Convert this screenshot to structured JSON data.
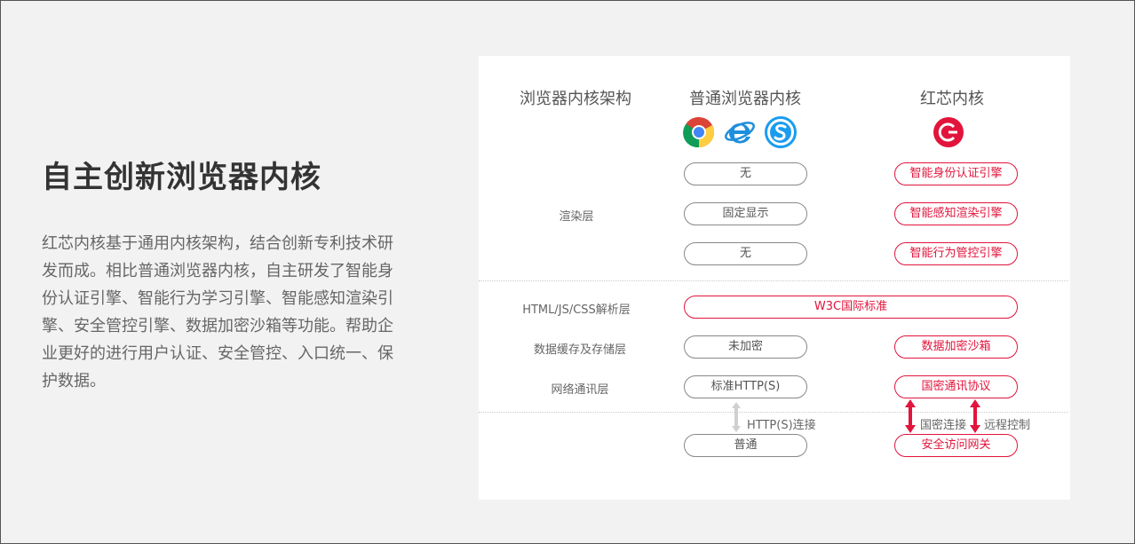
{
  "intro": {
    "title": "自主创新浏览器内核",
    "description": "红芯内核基于通用内核架构，结合创新专利技术研发而成。相比普通浏览器内核，自主研发了智能身份认证引擎、智能行为学习引擎、智能感知渲染引擎、安全管控引擎、数据加密沙箱等功能。帮助企业更好的进行用户认证、安全管控、入口统一、保护数据。"
  },
  "table": {
    "headers": {
      "architecture": "浏览器内核架构",
      "normal": "普通浏览器内核",
      "redcore": "红芯内核"
    },
    "render_layer": {
      "label": "渲染层",
      "normal": [
        "无",
        "固定显示",
        "无"
      ],
      "redcore": [
        "智能身份认证引擎",
        "智能感知渲染引擎",
        "智能行为管控引擎"
      ]
    },
    "parse_layer": {
      "label": "HTML/JS/CSS解析层",
      "shared": "W3C国际标准"
    },
    "storage_layer": {
      "label": "数据缓存及存储层",
      "normal": "未加密",
      "redcore": "数据加密沙箱"
    },
    "network_layer": {
      "label": "网络通讯层",
      "normal": "标准HTTP(S)",
      "redcore": "国密通讯协议"
    },
    "connection": {
      "normal_note": "HTTP(S)连接",
      "redcore_note_left": "国密连接",
      "redcore_note_right": "远程控制",
      "normal_end": "普通",
      "redcore_end": "安全访问网关"
    }
  },
  "colors": {
    "accent": "#e2143c",
    "title": "#333333",
    "text": "#666666",
    "background": "#f2f2f2"
  },
  "icons": [
    "chrome-icon",
    "ie-icon",
    "sogou-browser-icon",
    "redcore-logo-icon"
  ]
}
